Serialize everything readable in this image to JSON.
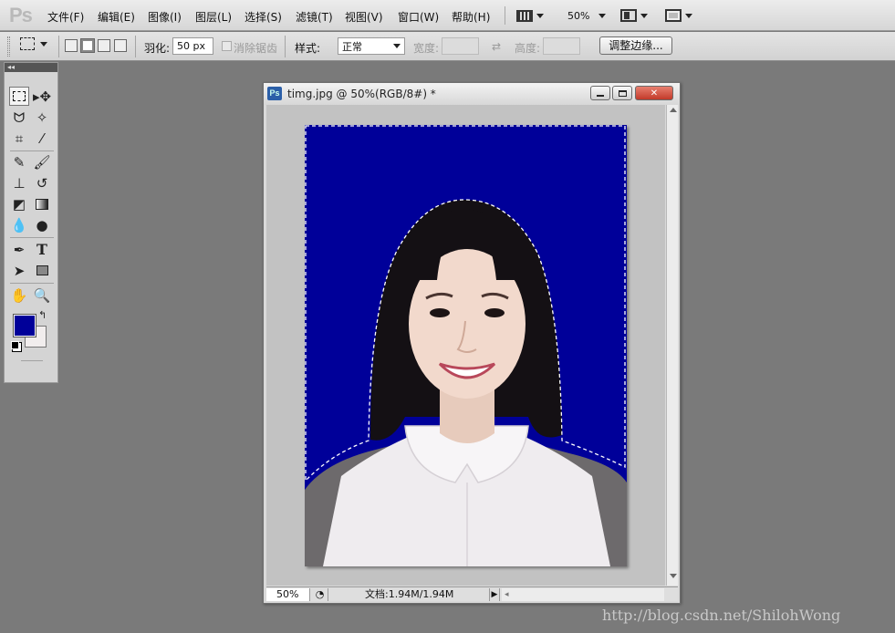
{
  "app": {
    "logo": "Ps"
  },
  "menu": {
    "items": [
      "文件(F)",
      "编辑(E)",
      "图像(I)",
      "图层(L)",
      "选择(S)",
      "滤镜(T)",
      "视图(V)",
      "窗口(W)",
      "帮助(H)"
    ],
    "zoom": "50%"
  },
  "options": {
    "feather_label": "羽化:",
    "feather_value": "50 px",
    "antialias_label": "消除锯齿",
    "style_label": "样式:",
    "style_value": "正常",
    "width_label": "宽度:",
    "height_label": "高度:",
    "refine_edge_button": "调整边缘..."
  },
  "tools": {
    "collapse_glyph": "◂◂",
    "foreground_color": "#000099",
    "background_color": "#f1eded"
  },
  "document": {
    "title": "timg.jpg @ 50%(RGB/8#) *",
    "zoom": "50%",
    "doc_size": "文档:1.94M/1.94M",
    "background_color": "#000099"
  },
  "watermark": "http://blog.csdn.net/ShilohWong"
}
